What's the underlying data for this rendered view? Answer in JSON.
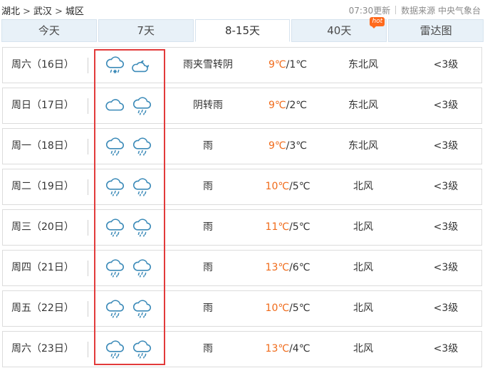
{
  "breadcrumb": {
    "province": "湖北",
    "city": "武汉",
    "district": "城区",
    "separator": ">"
  },
  "update": {
    "time_text": "07:30更新",
    "source_text": "数据来源 中央气象台"
  },
  "tabs": [
    {
      "label": "今天"
    },
    {
      "label": "7天"
    },
    {
      "label": "8-15天",
      "active": true
    },
    {
      "label": "40天",
      "badge": "hot"
    },
    {
      "label": "雷达图"
    }
  ],
  "colors": {
    "high_temp": "#f06a19",
    "icon_stroke": "#3b8ab8",
    "highlight_box": "#e23a3a"
  },
  "forecast": [
    {
      "day": "周六（16日）",
      "icons": [
        "cloud-snow-icon",
        "cloud-moon-icon"
      ],
      "desc": "雨夹雪转阴",
      "high": "9℃",
      "low": "/1℃",
      "wind": "东北风",
      "level": "<3级"
    },
    {
      "day": "周日（17日）",
      "icons": [
        "cloud-icon",
        "cloud-rain-icon"
      ],
      "desc": "阴转雨",
      "high": "9℃",
      "low": "/2℃",
      "wind": "东北风",
      "level": "<3级"
    },
    {
      "day": "周一（18日）",
      "icons": [
        "cloud-rain-icon",
        "cloud-rain-icon"
      ],
      "desc": "雨",
      "high": "9℃",
      "low": "/3℃",
      "wind": "东北风",
      "level": "<3级"
    },
    {
      "day": "周二（19日）",
      "icons": [
        "cloud-rain-icon",
        "cloud-rain-icon"
      ],
      "desc": "雨",
      "high": "10℃",
      "low": "/5℃",
      "wind": "北风",
      "level": "<3级"
    },
    {
      "day": "周三（20日）",
      "icons": [
        "cloud-rain-icon",
        "cloud-rain-icon"
      ],
      "desc": "雨",
      "high": "11℃",
      "low": "/5℃",
      "wind": "北风",
      "level": "<3级"
    },
    {
      "day": "周四（21日）",
      "icons": [
        "cloud-rain-icon",
        "cloud-rain-icon"
      ],
      "desc": "雨",
      "high": "13℃",
      "low": "/6℃",
      "wind": "北风",
      "level": "<3级"
    },
    {
      "day": "周五（22日）",
      "icons": [
        "cloud-rain-icon",
        "cloud-rain-icon"
      ],
      "desc": "雨",
      "high": "10℃",
      "low": "/5℃",
      "wind": "北风",
      "level": "<3级"
    },
    {
      "day": "周六（23日）",
      "icons": [
        "cloud-rain-icon",
        "cloud-rain-icon"
      ],
      "desc": "雨",
      "high": "13℃",
      "low": "/4℃",
      "wind": "北风",
      "level": "<3级"
    }
  ]
}
